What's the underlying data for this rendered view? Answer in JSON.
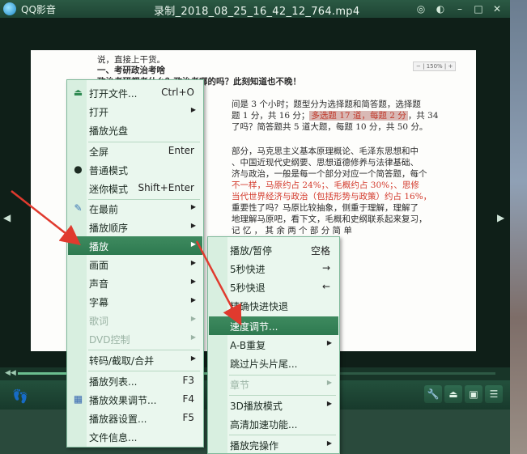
{
  "window": {
    "app_name": "QQ影音",
    "file_title": "录制_2018_08_25_16_42_12_764.mp4"
  },
  "document": {
    "lines": [
      "说，直接上干货。",
      "一、考研政治考啥",
      "政治考研都考什么？政治考哪的吗？此刻知道也不晚！",
      "间是 3 个小时；题型分为选择题和简答题，选择题",
      "题 1 分，共 16 分；",
      "多选题 17 道，每题 2 分",
      "，共 34",
      "了吗？简答题共 5 道大题，每题 10 分，共 50 分。",
      "部分，马克思主义基本原理概论、毛泽东思想和中",
      "、中国近现代史纲要、思想道德修养与法律基础、",
      "济与政治，一般是每一个部分对应一个简答题，每个",
      "不一样，马原约占 24%；、毛概约占 30%；、思修",
      "当代世界经济与政治（包括形势与政策）约占 16%，",
      "重要性了吗？马原比较抽象，侧重于理解，理解了",
      "地理解马原吧，看下文，毛概和史纲联系起来复习，",
      "记 忆 ， 其 余 两 个 部 分 简 单"
    ],
    "zoom_label": "150%"
  },
  "main_menu": {
    "items": [
      {
        "label": "打开文件...",
        "shortcut": "Ctrl+O",
        "icon": "eject-icon"
      },
      {
        "label": "打开",
        "submenu": true
      },
      {
        "label": "播放光盘"
      },
      {
        "label": "全屏",
        "shortcut": "Enter"
      },
      {
        "label": "普通模式",
        "checked": true
      },
      {
        "label": "迷你模式",
        "shortcut": "Shift+Enter"
      },
      {
        "label": "在最前",
        "submenu": true,
        "icon": "pin-icon"
      },
      {
        "label": "播放顺序",
        "submenu": true
      },
      {
        "label": "播放",
        "submenu": true,
        "active": true
      },
      {
        "label": "画面",
        "submenu": true
      },
      {
        "label": "声音",
        "submenu": true
      },
      {
        "label": "字幕",
        "submenu": true
      },
      {
        "label": "歌词",
        "submenu": true,
        "disabled": true
      },
      {
        "label": "DVD控制",
        "submenu": true,
        "disabled": true
      },
      {
        "label": "转码/截取/合并",
        "submenu": true
      },
      {
        "label": "播放列表...",
        "shortcut": "F3"
      },
      {
        "label": "播放效果调节...",
        "shortcut": "F4",
        "icon": "equalizer-icon"
      },
      {
        "label": "播放器设置...",
        "shortcut": "F5"
      },
      {
        "label": "文件信息..."
      }
    ]
  },
  "play_submenu": {
    "items": [
      {
        "label": "播放/暂停",
        "shortcut": "空格"
      },
      {
        "label": "5秒快进",
        "shortcut": "→"
      },
      {
        "label": "5秒快退",
        "shortcut": "←"
      },
      {
        "label": "精确快进快退"
      },
      {
        "label": "速度调节...",
        "active": true
      },
      {
        "label": "A-B重复",
        "submenu": true
      },
      {
        "label": "跳过片头片尾..."
      },
      {
        "label": "章节",
        "submenu": true,
        "disabled": true
      },
      {
        "label": "3D播放模式",
        "submenu": true
      },
      {
        "label": "高清加速功能..."
      },
      {
        "label": "播放完操作",
        "submenu": true
      }
    ]
  },
  "colors": {
    "accent": "#2e7a50",
    "annotation_red": "#e03a2e"
  }
}
